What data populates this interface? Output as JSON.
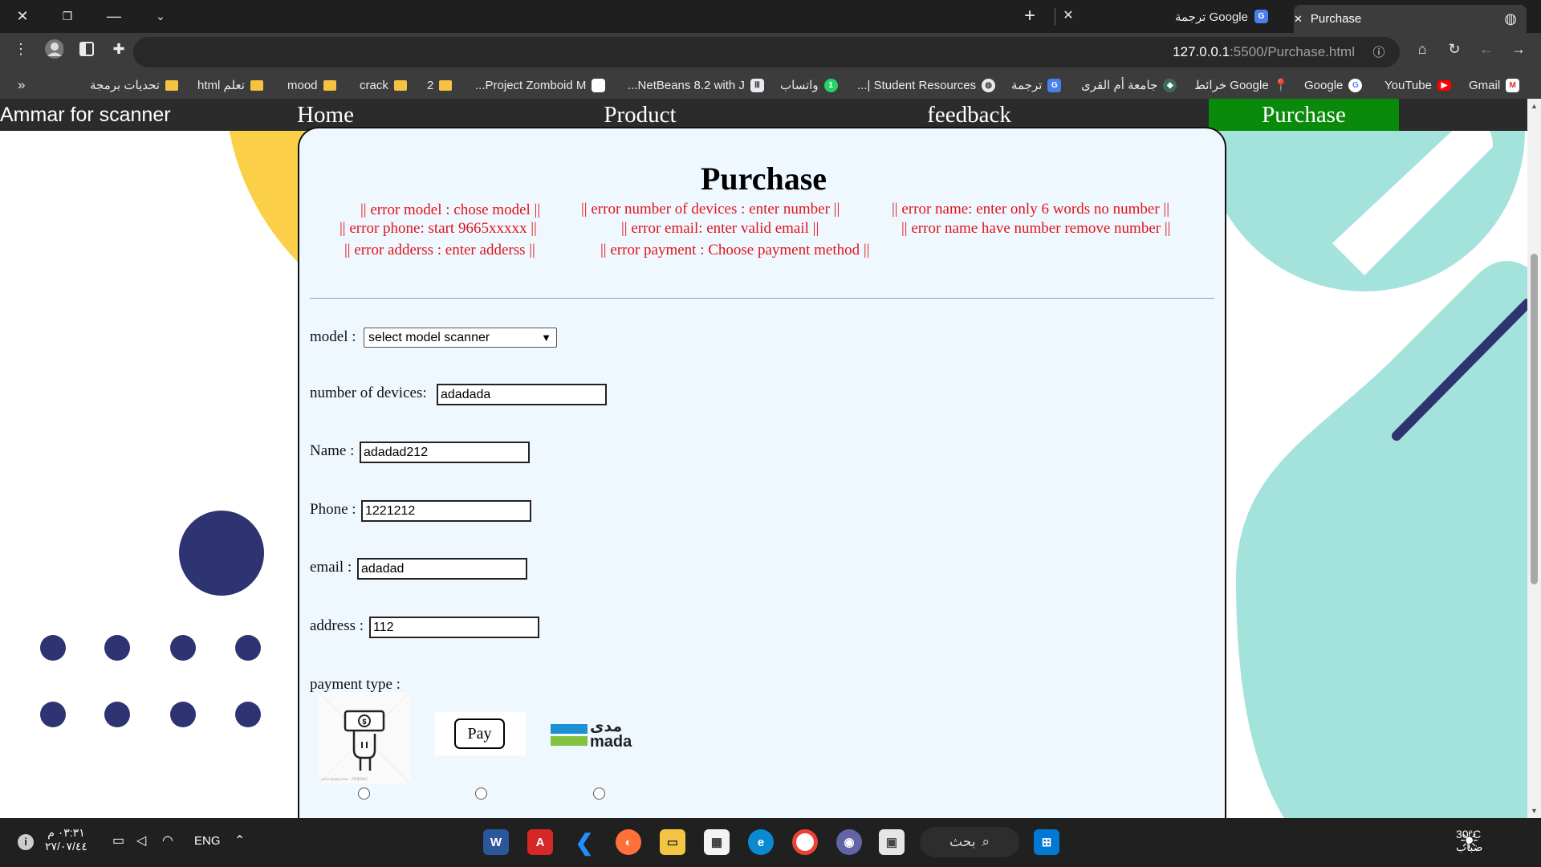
{
  "browser": {
    "tabs": [
      {
        "title": "Google ترجمة"
      },
      {
        "title": "Purchase"
      }
    ],
    "new_tab_symbol": "+",
    "url_host": "127.0.0.1",
    "url_path": ":5500/Purchase.html",
    "bookmarks": [
      {
        "label": "Gmail",
        "icon": "gmail-icon"
      },
      {
        "label": "YouTube",
        "icon": "youtube-icon"
      },
      {
        "label": "Google",
        "icon": "google-icon"
      },
      {
        "label": "Google خرائط",
        "icon": "maps-icon"
      },
      {
        "label": "جامعة أم القرى",
        "icon": "university-icon"
      },
      {
        "label": "ترجمة",
        "icon": "translate-icon"
      },
      {
        "label": "Student Resources |...",
        "icon": "globe-icon"
      },
      {
        "label": "واتساب",
        "icon": "whatsapp-icon"
      },
      {
        "label": "NetBeans 8.2 with J...",
        "icon": "netbeans-icon"
      },
      {
        "label": "Project Zomboid M...",
        "icon": "page-icon"
      },
      {
        "label": "2",
        "icon": "folder-icon"
      },
      {
        "label": "crack",
        "icon": "folder-icon"
      },
      {
        "label": "mood",
        "icon": "folder-icon"
      },
      {
        "label": "تعلم html",
        "icon": "folder-icon"
      },
      {
        "label": "تحديات برمجة",
        "icon": "folder-icon"
      }
    ],
    "bookmarks_overflow": "«"
  },
  "nav": {
    "brand": "Ammar for scanner",
    "home": "Home",
    "product": "Product",
    "feedback": "feedback",
    "purchase": "Purchase",
    "active_color": "#0a8a0a"
  },
  "form": {
    "title": "Purchase",
    "errors": {
      "model": "|| error model : chose model ||",
      "devices": "|| error number of devices : enter number ||",
      "name_words": "|| error name: enter only 6 words no number ||",
      "phone": "|| error phone: start 9665xxxxx ||",
      "email": "|| error email: enter valid email ||",
      "name_number": "|| error name have number remove number ||",
      "address": "|| error adderss : enter adderss ||",
      "payment": "|| error payment : Choose payment method ||"
    },
    "model_label": "model :",
    "model_value": "select model scanner",
    "devices_label": "number of devices:",
    "devices_value": "adadada",
    "name_label": "Name :",
    "name_value": "adadad212",
    "phone_label": "Phone :",
    "phone_value": "1221212",
    "email_label": "email :",
    "email_value": "adadad",
    "address_label": "address :",
    "address_value": "112",
    "payment_label": "payment type :",
    "payment_options": [
      {
        "name": "cash",
        "icon": "cash-hand-icon",
        "caption": "www.alamy.com · 2T8E9BG"
      },
      {
        "name": "apple-pay",
        "icon": "apple-pay-icon",
        "text": "Pay"
      },
      {
        "name": "mada",
        "icon": "mada-icon",
        "text_ar": "مدى",
        "text_en": "mada"
      }
    ],
    "error_color": "#e0141a"
  },
  "taskbar": {
    "weather_temp": "30°C",
    "weather_desc": "ضباب",
    "search_label": "بحث",
    "time": "٠٣:٣١ م",
    "date": "٢٧/٠٧/٤٤",
    "language": "ENG"
  }
}
